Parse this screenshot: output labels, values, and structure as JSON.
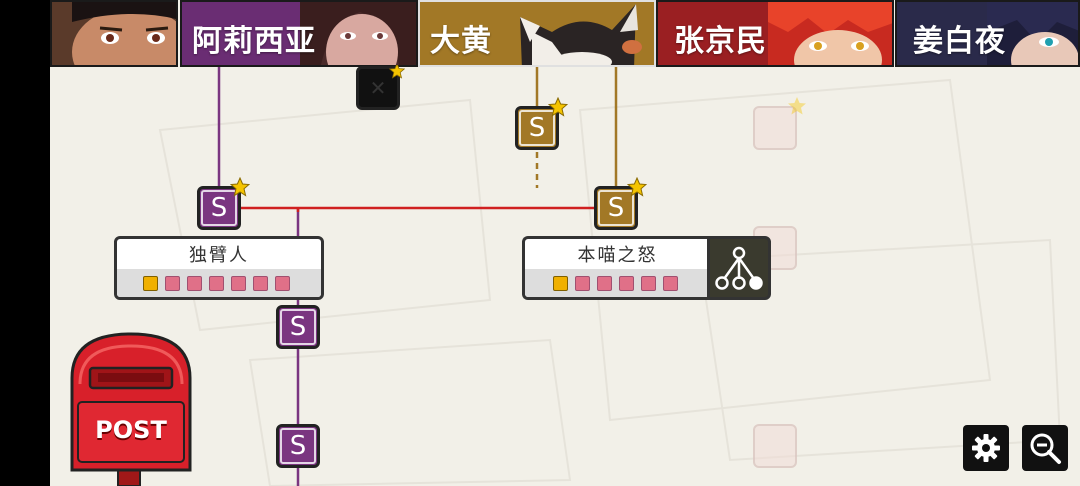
{
  "characters": [
    {
      "name": "",
      "color": "#3a3a3a"
    },
    {
      "name": "阿莉西亚",
      "color": "#6a2d73"
    },
    {
      "name": "大黄",
      "color": "#a27826"
    },
    {
      "name": "张京民",
      "color": "#9a1f22"
    },
    {
      "name": "姜白夜",
      "color": "#2a2a4a"
    }
  ],
  "cards": {
    "left": {
      "title": "独臂人",
      "progress_filled": 1,
      "progress_total": 7
    },
    "right": {
      "title": "本喵之怒",
      "progress_filled": 1,
      "progress_total": 6
    }
  },
  "node_label": "S",
  "mailbox": {
    "label": "POST"
  },
  "buttons": {
    "settings": "gear-icon",
    "zoom_out": "zoom-out-icon"
  },
  "colors": {
    "purple": "#7a3580",
    "gold": "#a27826",
    "red_line": "#d02020",
    "star": "#f5c400"
  }
}
